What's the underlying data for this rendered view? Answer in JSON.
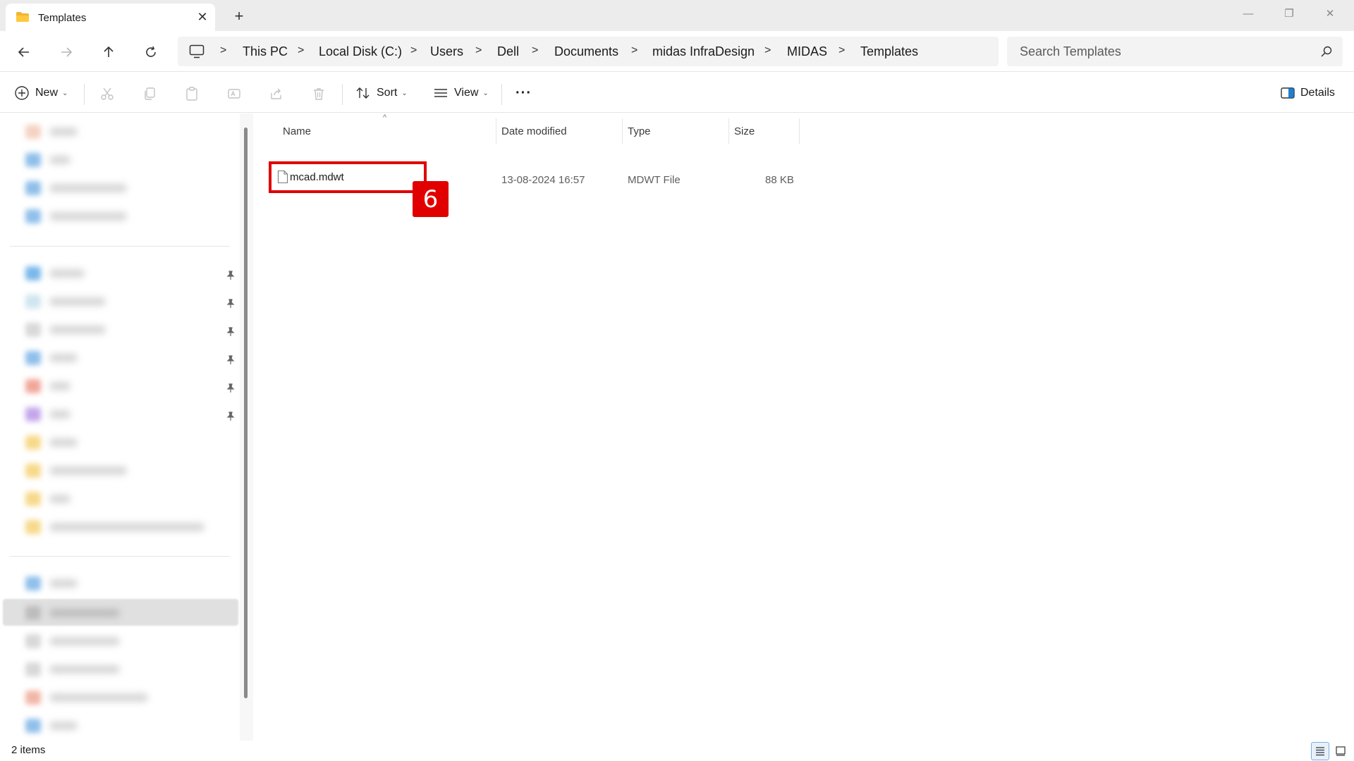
{
  "window": {
    "tab_title": "Templates",
    "close_glyph": "✕",
    "new_tab_glyph": "+",
    "minimize_glyph": "—",
    "restore_glyph": "❐",
    "window_close_glyph": "✕"
  },
  "address": {
    "breadcrumbs": [
      "This PC",
      "Local Disk (C:)",
      "Users",
      "Dell",
      "Documents",
      "midas InfraDesign",
      "MIDAS",
      "Templates"
    ],
    "separator": ">"
  },
  "search": {
    "placeholder": "Search Templates"
  },
  "toolbar": {
    "new_label": "New",
    "sort_label": "Sort",
    "view_label": "View",
    "more_label": "···",
    "details_label": "Details",
    "chevron": "⌄"
  },
  "columns": {
    "name": "Name",
    "date_modified": "Date modified",
    "type": "Type",
    "size": "Size",
    "sort_indicator": "^"
  },
  "files": [
    {
      "name": "mcad.mdwt",
      "date_modified": "13-08-2024 16:57",
      "type": "MDWT File",
      "size": "88 KB"
    }
  ],
  "annotation": {
    "step_number": "6",
    "color": "#e00000"
  },
  "status": {
    "item_count": "2 items"
  },
  "colors": {
    "accent": "#0067c0",
    "folder": "#f2b531"
  }
}
